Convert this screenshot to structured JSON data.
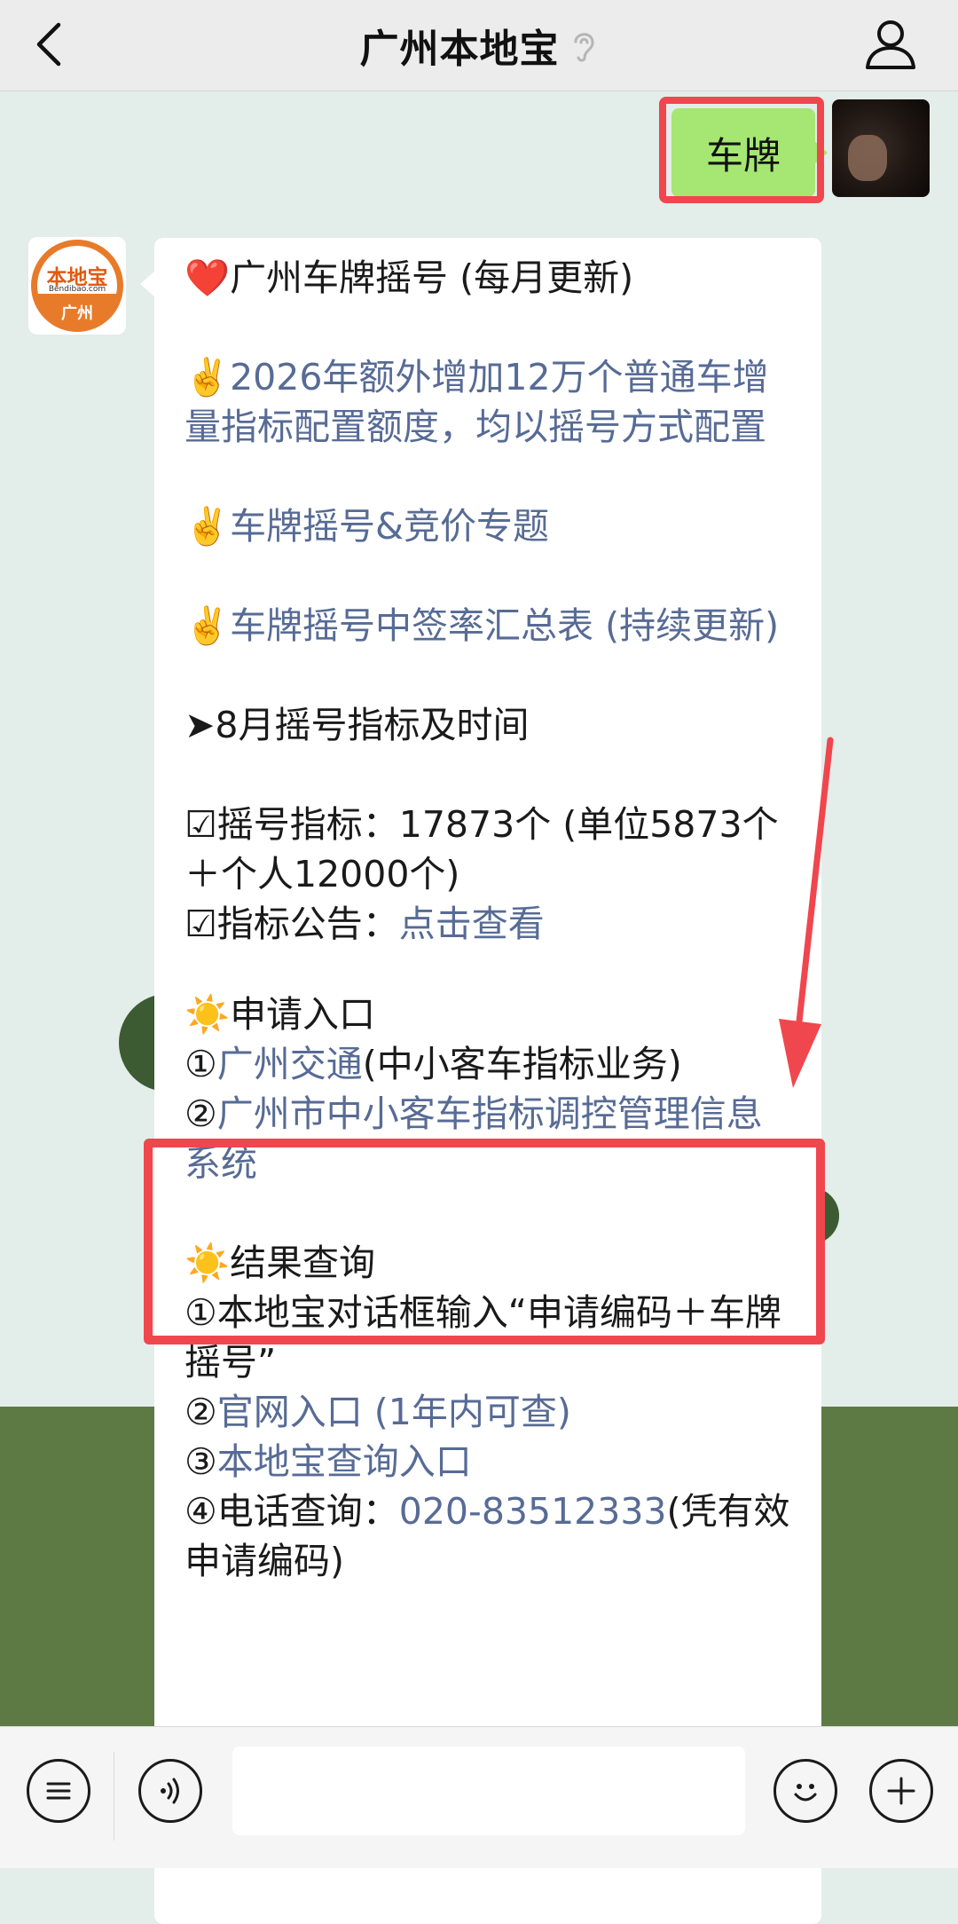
{
  "header": {
    "title": "广州本地宝"
  },
  "user_message": {
    "text": "车牌"
  },
  "bot": {
    "avatar_text_top": "本地宝",
    "avatar_text_mid": "Bendibao.com",
    "avatar_text_bottom": "广州"
  },
  "message": {
    "heading_icon": "❤️",
    "heading": "广州车牌摇号 (每月更新)",
    "v1_icon": "✌️",
    "v1_text": "2026年额外增加12万个普通车增量指标配置额度，均以摇号方式配置",
    "v2_icon": "✌️",
    "v2_text": "车牌摇号&竞价专题",
    "v3_icon": "✌️",
    "v3_text": "车牌摇号中签率汇总表 (持续更新)",
    "section1": "➤8月摇号指标及时间",
    "quota_prefix": "☑摇号指标：",
    "quota_text": "17873个 (单位5873个＋个人12000个)",
    "notice_prefix": "☑指标公告：",
    "notice_link": "点击查看",
    "apply_icon": "☀️",
    "apply_title": "申请入口",
    "apply1_num": "①",
    "apply1_link": "广州交通",
    "apply1_suffix": "(中小客车指标业务)",
    "apply2_num": "②",
    "apply2_link": "广州市中小客车指标调控管理信息系统",
    "result_icon": "☀️",
    "result_title": "结果查询",
    "r1": "①本地宝对话框输入“申请编码＋车牌摇号”",
    "r2_num": "②",
    "r2_link": "官网入口 (1年内可查)",
    "r3_num": "③",
    "r3_link": "本地宝查询入口",
    "r4_prefix": "④电话查询：",
    "r4_phone": "020-83512333",
    "r4_suffix": "(凭有效申请编码)"
  },
  "input_bar": {
    "menu_icon": "menu-icon",
    "voice_icon": "voice-icon",
    "emoji_icon": "emoji-icon",
    "plus_icon": "plus-icon"
  },
  "colors": {
    "link": "#576b95",
    "highlight": "#f0464e",
    "user_bubble": "#a5e772"
  }
}
